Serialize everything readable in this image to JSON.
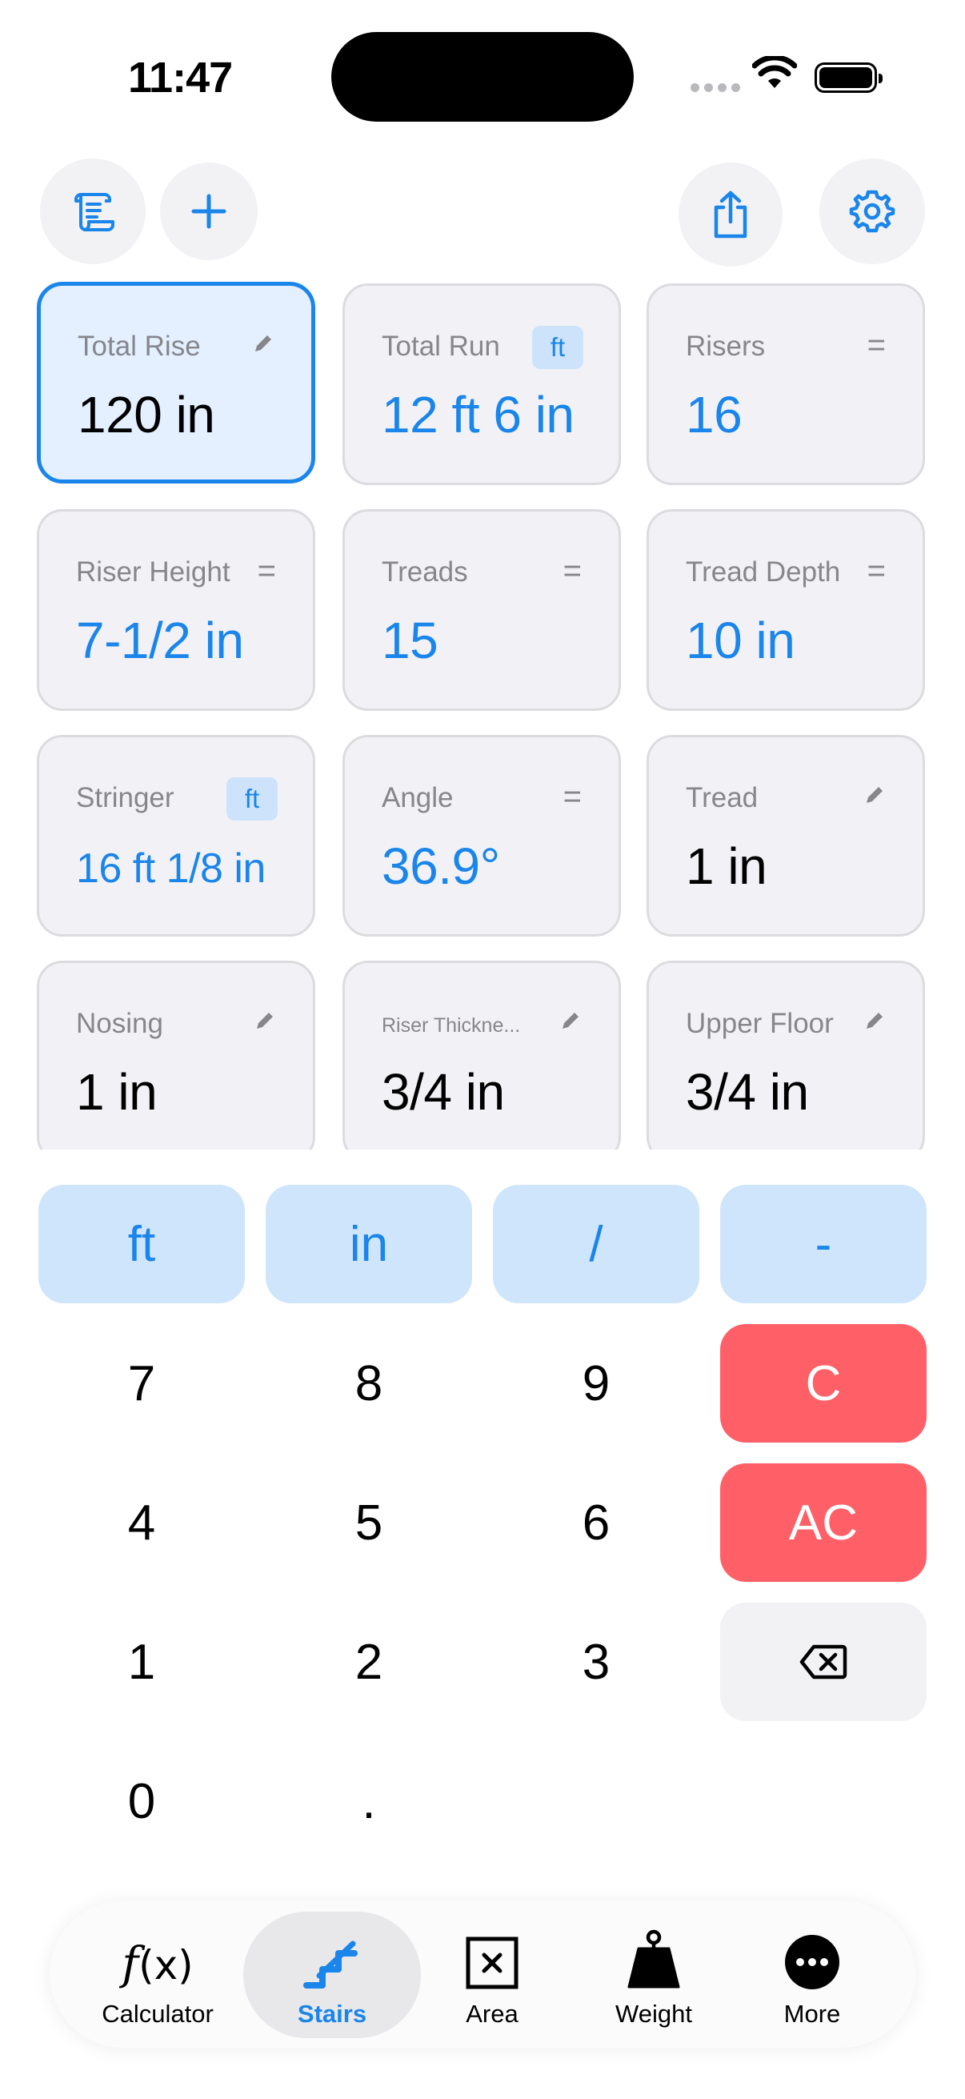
{
  "status_bar": {
    "time": "11:47"
  },
  "toolbar": {
    "history_icon": "scroll-icon",
    "add_icon": "plus-icon",
    "share_icon": "share-icon",
    "settings_icon": "gear-icon"
  },
  "cards": {
    "total_rise": {
      "label": "Total Rise",
      "value": "120 in",
      "indicator": "pencil-icon"
    },
    "total_run": {
      "label": "Total Run",
      "value": "12 ft 6 in",
      "badge": "ft"
    },
    "risers": {
      "label": "Risers",
      "value": "16",
      "indicator": "="
    },
    "riser_height": {
      "label": "Riser Height",
      "value": "7-1/2 in",
      "indicator": "="
    },
    "treads": {
      "label": "Treads",
      "value": "15",
      "indicator": "="
    },
    "tread_depth": {
      "label": "Tread Depth",
      "value": "10 in",
      "indicator": "="
    },
    "stringer": {
      "label": "Stringer",
      "value": "16 ft 1/8 in",
      "badge": "ft"
    },
    "angle": {
      "label": "Angle",
      "value": "36.9°",
      "indicator": "="
    },
    "tread": {
      "label": "Tread",
      "value": "1 in",
      "indicator": "pencil-icon"
    },
    "nosing": {
      "label": "Nosing",
      "value": "1 in",
      "indicator": "pencil-icon"
    },
    "riser_thickness": {
      "label": "Riser Thickne...",
      "value": "3/4 in",
      "indicator": "pencil-icon"
    },
    "upper_floor": {
      "label": "Upper Floor",
      "value": "3/4 in",
      "indicator": "pencil-icon"
    }
  },
  "keypad": {
    "units": [
      "ft",
      "in",
      "/",
      "-"
    ],
    "digits": {
      "d7": "7",
      "d8": "8",
      "d9": "9",
      "d4": "4",
      "d5": "5",
      "d6": "6",
      "d1": "1",
      "d2": "2",
      "d3": "3",
      "d0": "0",
      "dot": "."
    },
    "clear": "C",
    "all_clear": "AC",
    "backspace_icon": "delete-backward-icon"
  },
  "tabbar": {
    "tabs": [
      {
        "label": "Calculator",
        "icon": "function-icon"
      },
      {
        "label": "Stairs",
        "icon": "stairs-icon",
        "selected": true
      },
      {
        "label": "Area",
        "icon": "area-box-icon"
      },
      {
        "label": "Weight",
        "icon": "weight-icon"
      },
      {
        "label": "More",
        "icon": "more-icon"
      }
    ]
  },
  "colors": {
    "accent": "#1a85ea",
    "active_card_bg": "#e4f0ff",
    "unit_key_bg": "#cfe5fb",
    "danger": "#ff6068",
    "card_bg": "#f2f2f6"
  }
}
